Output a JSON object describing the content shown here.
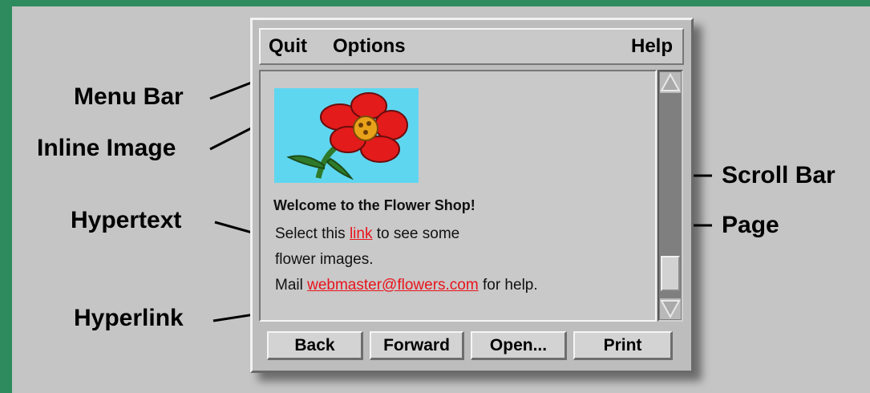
{
  "callouts": {
    "menu_bar": "Menu Bar",
    "inline_image": "Inline Image",
    "hypertext": "Hypertext",
    "hyperlink": "Hyperlink",
    "scroll_bar": "Scroll Bar",
    "page": "Page"
  },
  "menu": {
    "quit": "Quit",
    "options": "Options",
    "help": "Help"
  },
  "page": {
    "heading": "Welcome to the Flower Shop!",
    "line1_before": "Select this ",
    "line1_link": "link",
    "line1_after": " to see some",
    "line2": "flower images.",
    "line3_before": "Mail ",
    "line3_link": "webmaster@flowers.com",
    "line3_after": " for help."
  },
  "buttons": {
    "back": "Back",
    "forward": "Forward",
    "open": "Open...",
    "print": "Print"
  },
  "colors": {
    "outer_border": "#2e8b5e",
    "background": "#c5c5c5",
    "link": "#e8141c",
    "image_sky": "#5fd6f0",
    "flower": "#e31b1b",
    "flower_center": "#e8a21a",
    "stem": "#2f7a2a"
  },
  "icons": {
    "scroll_up": "triangle-up-icon",
    "scroll_down": "triangle-down-icon"
  }
}
